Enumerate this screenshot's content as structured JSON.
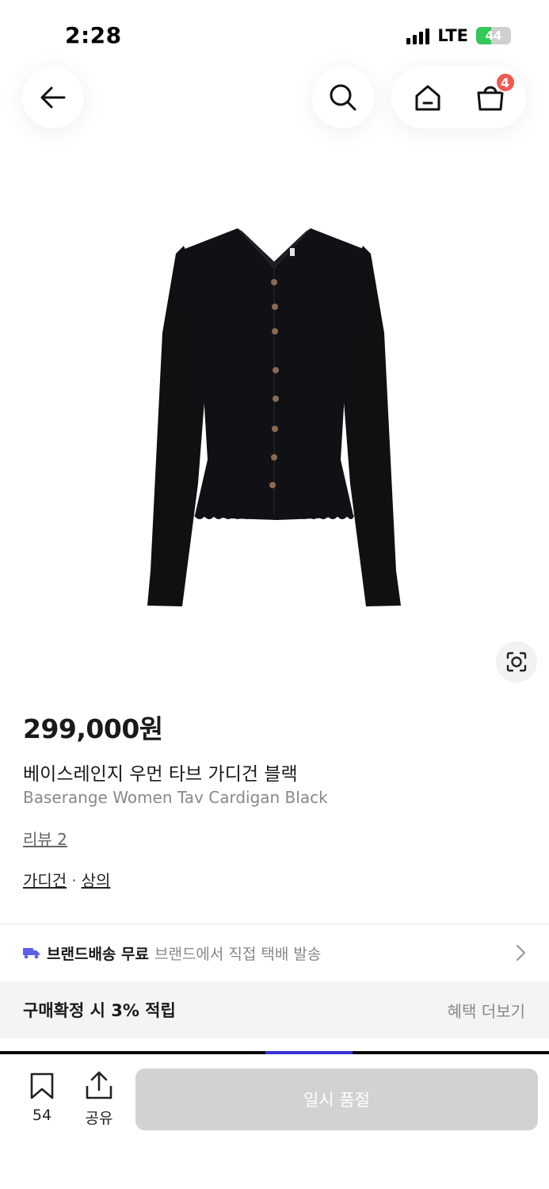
{
  "status_bar": {
    "time": "2:28",
    "network": "LTE",
    "battery": "44",
    "battery_level": 0.44
  },
  "nav": {
    "cart_count": "4"
  },
  "product": {
    "price": "299,000원",
    "name_ko": "베이스레인지 우먼 타브 가디건 블랙",
    "name_en": "Baserange Women Tav Cardigan Black",
    "reviews": "리뷰 2",
    "category_1": "가디건",
    "category_sep": "·",
    "category_2": "상의"
  },
  "delivery": {
    "bold": "브랜드배송 무료",
    "sub": "브랜드에서 직접 택배 발송"
  },
  "benefit": {
    "text": "구매확정 시 3% 적립",
    "link": "혜택 더보기"
  },
  "bottom": {
    "bookmark_count": "54",
    "share_label": "공유",
    "soldout_label": "일시 품절"
  },
  "colors": {
    "badge": "#ef5a4f",
    "battery": "#34c759",
    "delivery_icon": "#5b5fe6",
    "button_disabled": "#d2d2d3"
  },
  "icons": [
    "back-arrow-icon",
    "search-icon",
    "home-icon",
    "shopping-bag-icon",
    "lens-scan-icon",
    "truck-icon",
    "chevron-right-icon",
    "bookmark-icon",
    "share-icon"
  ]
}
